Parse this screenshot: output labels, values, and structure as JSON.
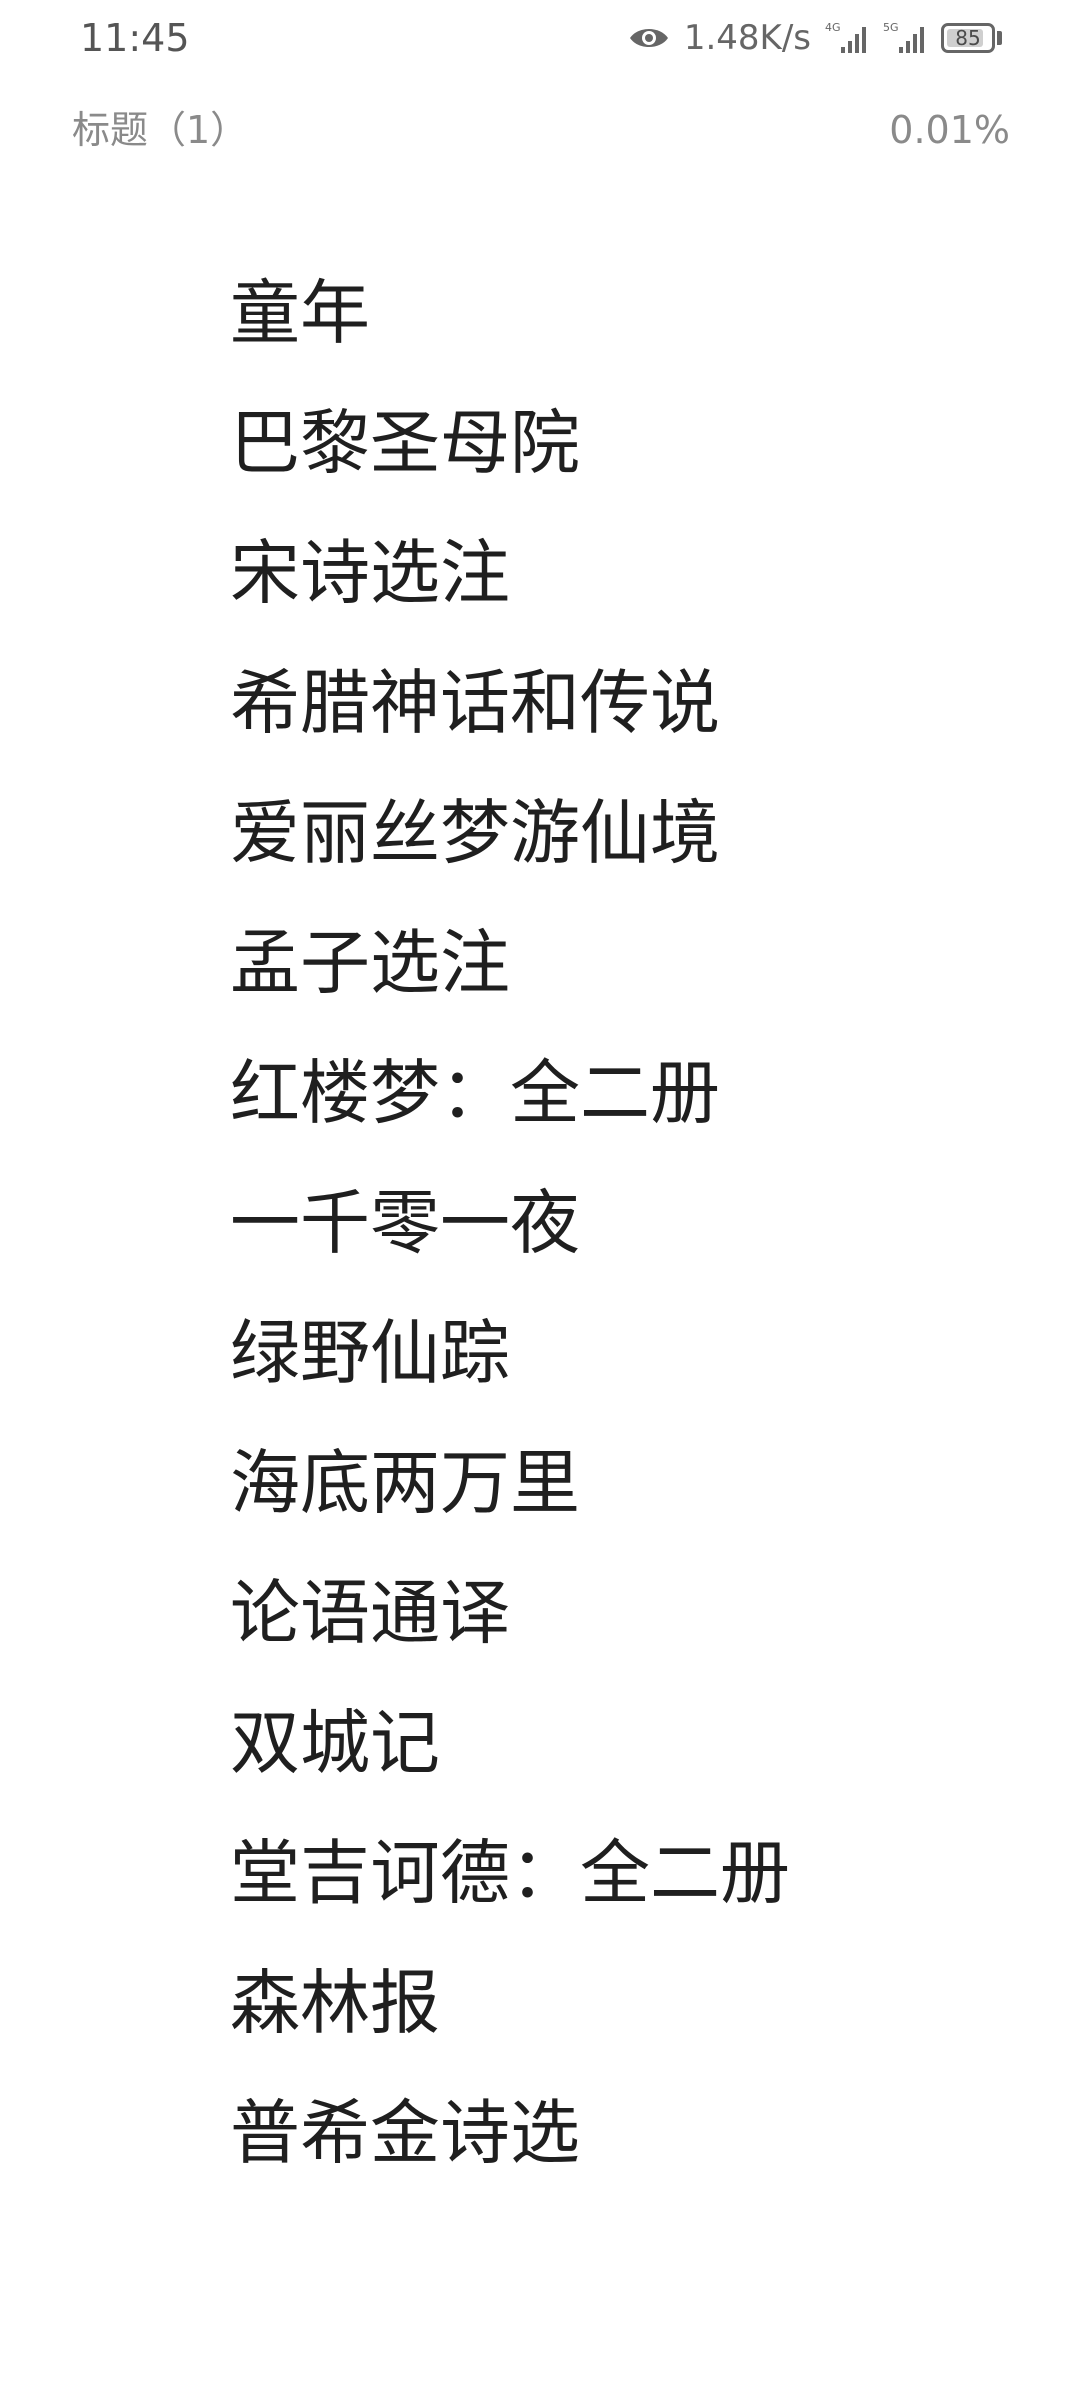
{
  "status_bar": {
    "time": "11:45",
    "net_speed": "1.48K/s",
    "signal_1_label": "4G",
    "signal_2_label": "5G",
    "battery_level": "85",
    "icons": [
      "eye-icon",
      "signal-4g-icon",
      "signal-5g-icon",
      "battery-icon"
    ]
  },
  "reader": {
    "chapter_title": "标题（1）",
    "progress": "0.01%"
  },
  "book_list": [
    "童年",
    "巴黎圣母院",
    "宋诗选注",
    "希腊神话和传说",
    "爱丽丝梦游仙境",
    "孟子选注",
    "红楼梦：全二册",
    "一千零一夜",
    "绿野仙踪",
    "海底两万里",
    "论语通译",
    "双城记",
    "堂吉诃德：全二册",
    "森林报",
    "普希金诗选"
  ]
}
